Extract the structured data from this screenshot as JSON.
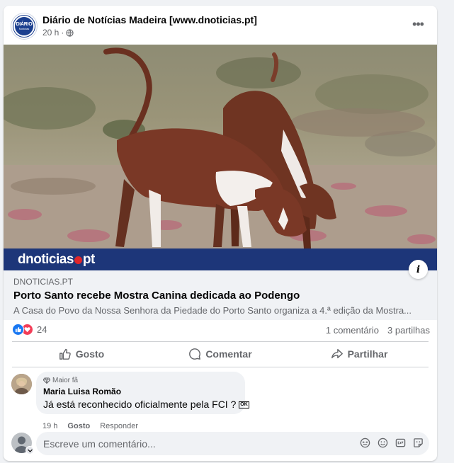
{
  "post": {
    "page_name": "Diário de Notícias Madeira [www.dnoticias.pt]",
    "avatar_text_top": "DIÁRIO",
    "avatar_text_bottom": "Notícias",
    "time": "20 h",
    "separator": "·"
  },
  "link": {
    "brand_left": "dnoticias",
    "brand_right": "pt",
    "info_icon": "i",
    "domain": "DNOTICIAS.PT",
    "title": "Porto Santo recebe Mostra Canina dedicada ao Podengo",
    "description": "A Casa do Povo da Nossa Senhora da Piedade do Porto Santo organiza a 4.ª edição da Mostra..."
  },
  "stats": {
    "reaction_count": "24",
    "comments": "1 comentário",
    "shares": "3 partilhas"
  },
  "actions": {
    "like": "Gosto",
    "comment": "Comentar",
    "share": "Partilhar"
  },
  "comment": {
    "badge": "Maior fã",
    "author": "Maria Luisa Romão",
    "text": "Já está reconhecido oficialmente pela FCI ?",
    "emoji_text": "OK",
    "time": "19 h",
    "like": "Gosto",
    "reply": "Responder"
  },
  "composer": {
    "placeholder": "Escreve um comentário..."
  },
  "colors": {
    "brand_blue": "#1d3679",
    "like_blue": "#1877f2",
    "love_red": "#f33e58",
    "brand_dot_red": "#e0262b"
  },
  "icons": [
    "globe-icon",
    "more-icon",
    "info-icon",
    "like-reaction-icon",
    "love-reaction-icon",
    "thumbs-up-icon",
    "comment-icon",
    "share-icon",
    "diamond-icon",
    "chevron-down-icon",
    "sticker-icon",
    "emoji-icon",
    "gif-icon",
    "avatar-sticker-icon"
  ]
}
